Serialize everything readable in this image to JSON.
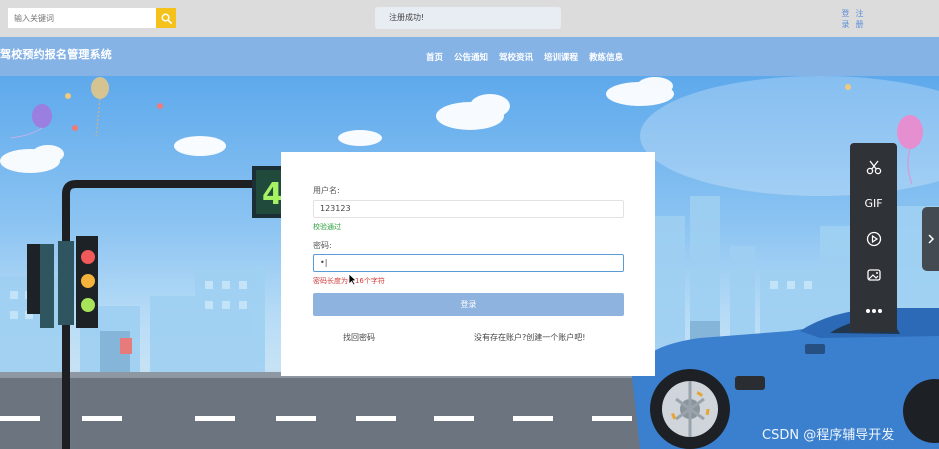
{
  "search": {
    "placeholder": "输入关键词"
  },
  "toast": "注册成功!",
  "auth": {
    "login": "登录",
    "register": "注册"
  },
  "site_title": "驾校预约报名管理系统",
  "nav": [
    "首页",
    "公告通知",
    "驾校资讯",
    "培训课程",
    "教练信息"
  ],
  "hero": {
    "traffic_counter": "4"
  },
  "login_form": {
    "username_label": "用户名:",
    "username_value": "123123",
    "username_status": "校验通过",
    "password_label": "密码:",
    "password_value": "•|",
    "password_error": "密码长度为6-16个字符",
    "submit_label": "登录",
    "forgot_link": "找回密码",
    "register_link": "没有存在账户?创建一个账户吧!"
  },
  "float_toolbar": {
    "items": [
      "scissors-icon",
      "GIF",
      "play-icon",
      "image-icon",
      "more-icon"
    ]
  },
  "watermark": "CSDN @程序辅导开发",
  "colors": {
    "accent": "#f4c21a",
    "nav_bg": "#86b3e6",
    "button": "#8eb3df",
    "ok": "#2e9e3e",
    "error": "#d23b3b"
  }
}
